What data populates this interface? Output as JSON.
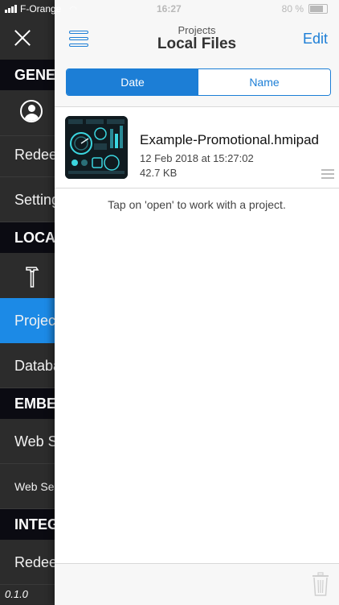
{
  "status": {
    "carrier": "F-Orange",
    "time": "16:27",
    "battery": "80 %"
  },
  "sidebar": {
    "sections": [
      {
        "header": "GENERAL",
        "items": [
          {
            "kind": "icon",
            "icon": "user-avatar-icon"
          },
          {
            "label": "Redeem"
          },
          {
            "label": "Settings"
          }
        ]
      },
      {
        "header": "LOCAL",
        "items": [
          {
            "kind": "icon",
            "icon": "hammer-icon"
          },
          {
            "label": "Projects",
            "active": true
          },
          {
            "label": "Databases"
          }
        ]
      },
      {
        "header": "EMBEDDED",
        "items": [
          {
            "label": "Web Server"
          },
          {
            "label": "Web Server",
            "small": true
          }
        ]
      },
      {
        "header": "INTEGRATOR",
        "items": [
          {
            "label": "Redeem"
          }
        ]
      }
    ],
    "version": "0.1.0"
  },
  "nav": {
    "subtitle": "Projects",
    "title": "Local Files",
    "edit_label": "Edit"
  },
  "sort": {
    "options": [
      "Date",
      "Name"
    ],
    "selected": "Date"
  },
  "files": [
    {
      "name": "Example-Promotional.hmipad",
      "date": "12 Feb 2018 at 15:27:02",
      "size": "42.7 KB"
    }
  ],
  "hint": "Tap on 'open' to work with a project.",
  "colors": {
    "accent": "#1c7ed6",
    "sidebar_bg": "#2c2c2c",
    "sidebar_header": "#0b0b12",
    "active_item": "#1c8ae6"
  }
}
